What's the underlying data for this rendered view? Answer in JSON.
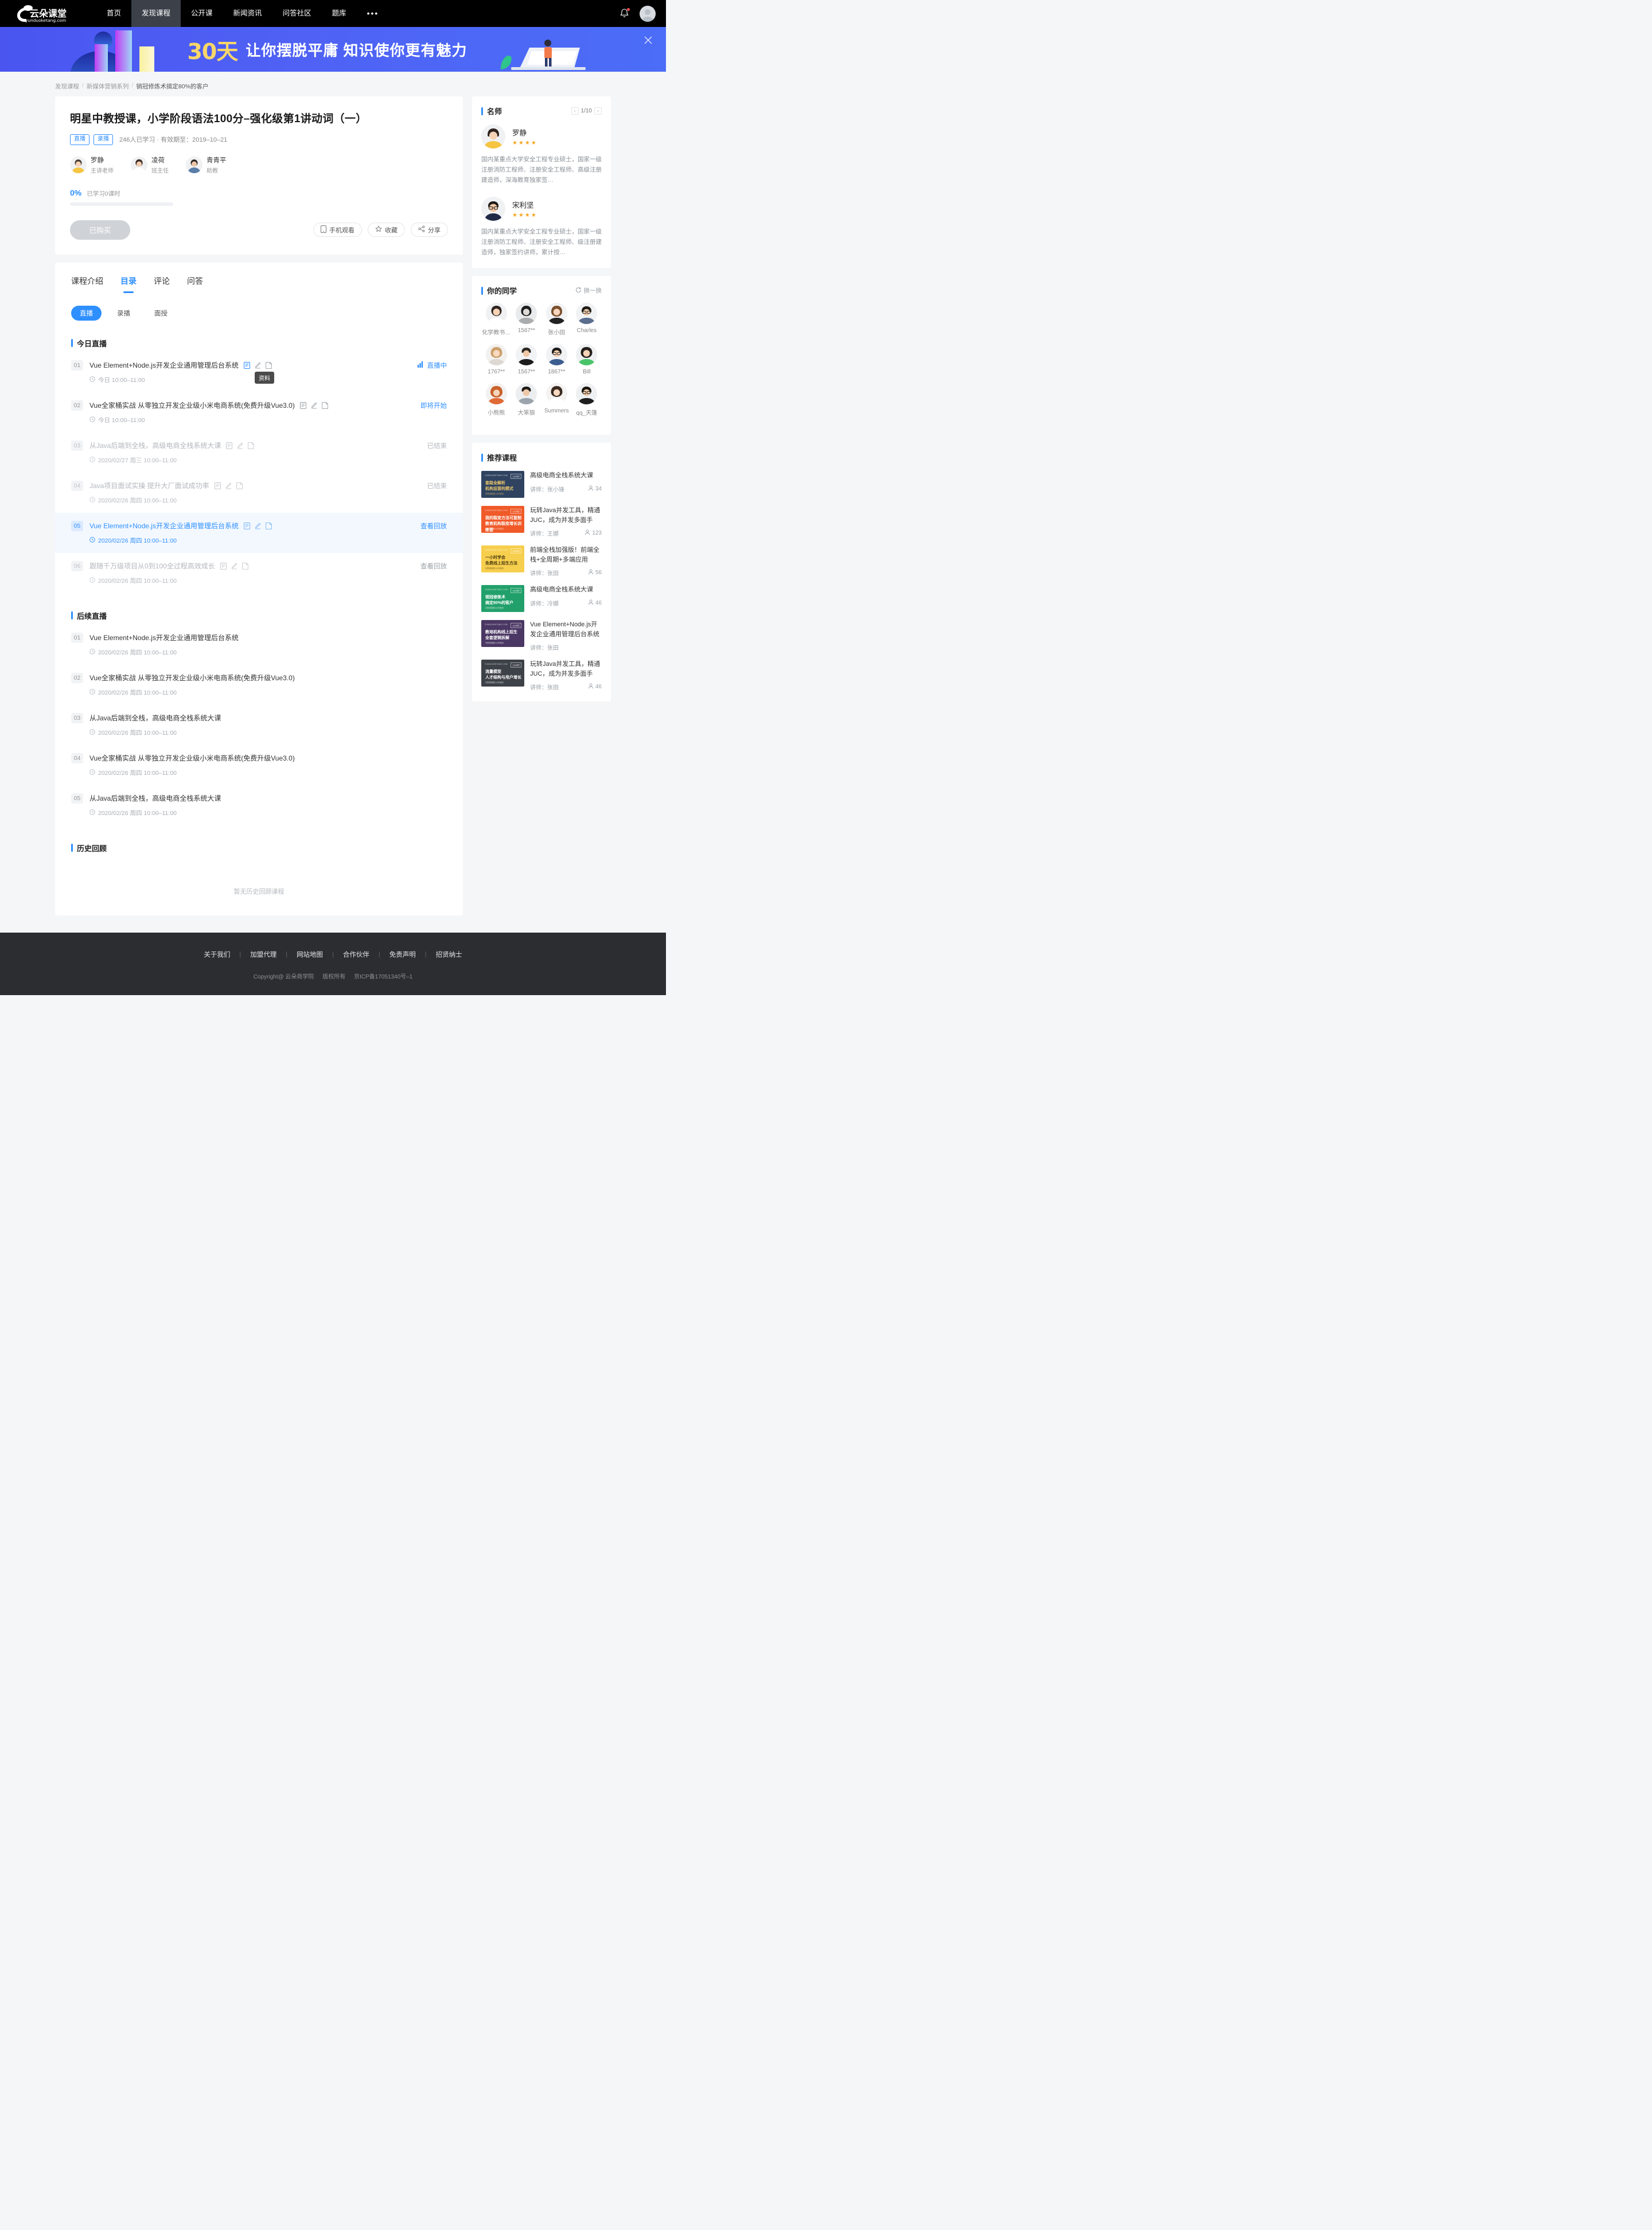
{
  "header": {
    "logo_text": "云朵课堂",
    "logo_sub": "yunduoketang.com",
    "nav": [
      {
        "label": "首页",
        "active": false
      },
      {
        "label": "发现课程",
        "active": true
      },
      {
        "label": "公开课",
        "active": false
      },
      {
        "label": "新闻资讯",
        "active": false
      },
      {
        "label": "问答社区",
        "active": false
      },
      {
        "label": "题库",
        "active": false
      }
    ],
    "more": "•••",
    "bell_icon": "bell-icon",
    "avatar_icon": "user-avatar"
  },
  "banner": {
    "highlight": "30天",
    "text": "让你摆脱平庸  知识使你更有魅力",
    "close_icon": "close-icon"
  },
  "breadcrumb": {
    "items": [
      "发现课程",
      "新媒体营销系列",
      "销冠修炼术搞定80%的客户"
    ],
    "separator": "/"
  },
  "course": {
    "title": "明星中教授课，小学阶段语法100分–强化级第1讲动词（一）",
    "tags": [
      "直播",
      "录播"
    ],
    "meta": "246人已学习 · 有效期至：2019–10–21",
    "teachers": [
      {
        "name": "罗静",
        "role": "主讲老师"
      },
      {
        "name": "凌荷",
        "role": "班主任"
      },
      {
        "name": "青青平",
        "role": "助教"
      }
    ],
    "progress_pct": "0%",
    "progress_label": "已学习0课时",
    "progress_value": 0,
    "buy_button": "已购买",
    "actions": [
      {
        "label": "手机观看",
        "icon": "mobile-icon"
      },
      {
        "label": "收藏",
        "icon": "star-icon"
      },
      {
        "label": "分享",
        "icon": "share-icon"
      }
    ]
  },
  "tabs": [
    {
      "label": "课程介绍",
      "active": false
    },
    {
      "label": "目录",
      "active": true
    },
    {
      "label": "评论",
      "active": false
    },
    {
      "label": "问答",
      "active": false
    }
  ],
  "subtabs": [
    {
      "label": "直播",
      "active": true
    },
    {
      "label": "录播",
      "active": false
    },
    {
      "label": "面授",
      "active": false
    }
  ],
  "tooltip": "资料",
  "sections": {
    "today": {
      "title": "今日直播",
      "lessons": [
        {
          "no": "01",
          "name": "Vue Element+Node.js开发企业通用管理后台系统",
          "time": "今日 10:00–11:00",
          "status": "直播中",
          "status_type": "live",
          "state": "active",
          "icons": [
            "doc-icon",
            "pen-icon",
            "note-icon"
          ]
        },
        {
          "no": "02",
          "name": "Vue全家桶实战 从零独立开发企业级小米电商系统(免费升级Vue3.0)",
          "time": "今日 10:00–11:00",
          "status": "即将开始",
          "status_type": "soon",
          "state": "normal",
          "icons": [
            "doc-icon",
            "pen-icon",
            "note-icon"
          ]
        },
        {
          "no": "03",
          "name": "从Java后端到全栈，高级电商全栈系统大课",
          "time": "2020/02/27 周三 10:00–11:00",
          "status": "已结束",
          "status_type": "ended",
          "state": "past",
          "icons": [
            "doc-icon",
            "pen-icon",
            "note-icon"
          ]
        },
        {
          "no": "04",
          "name": "Java项目面试实操 提升大厂面试成功率",
          "time": "2020/02/26 周四 10:00–11:00",
          "status": "已结束",
          "status_type": "ended",
          "state": "past",
          "icons": [
            "doc-icon",
            "pen-icon",
            "note-icon"
          ]
        },
        {
          "no": "05",
          "name": "Vue Element+Node.js开发企业通用管理后台系统",
          "time": "2020/02/26 周四 10:00–11:00",
          "status": "查看回放",
          "status_type": "replay",
          "state": "highlight",
          "icons": [
            "doc-icon",
            "pen-icon",
            "note-icon"
          ]
        },
        {
          "no": "06",
          "name": "跟随千万级项目从0到100全过程高效成长",
          "time": "2020/02/26 周四 10:00–11:00",
          "status": "查看回放",
          "status_type": "replay-grey",
          "state": "past",
          "icons": [
            "doc-icon",
            "pen-icon",
            "note-icon"
          ]
        }
      ]
    },
    "upcoming": {
      "title": "后续直播",
      "lessons": [
        {
          "no": "01",
          "name": "Vue Element+Node.js开发企业通用管理后台系统",
          "time": "2020/02/26 周四 10:00–11:00"
        },
        {
          "no": "02",
          "name": "Vue全家桶实战 从零独立开发企业级小米电商系统(免费升级Vue3.0)",
          "time": "2020/02/26 周四 10:00–11:00"
        },
        {
          "no": "03",
          "name": "从Java后端到全栈，高级电商全栈系统大课",
          "time": "2020/02/26 周四 10:00–11:00"
        },
        {
          "no": "04",
          "name": "Vue全家桶实战 从零独立开发企业级小米电商系统(免费升级Vue3.0)",
          "time": "2020/02/26 周四 10:00–11:00"
        },
        {
          "no": "05",
          "name": "从Java后端到全栈，高级电商全栈系统大课",
          "time": "2020/02/26 周四 10:00–11:00"
        }
      ]
    },
    "history": {
      "title": "历史回顾",
      "empty": "暂无历史回顾课程"
    }
  },
  "sidebar": {
    "teachers_panel": {
      "title": "名师",
      "page": "1/10",
      "prev_icon": "chevron-left-icon",
      "next_icon": "chevron-right-icon",
      "items": [
        {
          "name": "罗静",
          "stars": "★★★★",
          "desc": "国内某重点大学安全工程专业硕士，国家一级注册消防工程师、注册安全工程师、高级注册建造师，深海教育独家签…"
        },
        {
          "name": "宋利坚",
          "stars": "★★★★",
          "desc": "国内某重点大学安全工程专业硕士，国家一级注册消防工程师、注册安全工程师、级注册建造师，独家签约讲师，累计授…"
        }
      ]
    },
    "classmates_panel": {
      "title": "你的同学",
      "refresh_label": "换一换",
      "refresh_icon": "refresh-icon",
      "items": [
        {
          "name": "化学教书…"
        },
        {
          "name": "1567**"
        },
        {
          "name": "张小田"
        },
        {
          "name": "Charles"
        },
        {
          "name": "1767**"
        },
        {
          "name": "1567**"
        },
        {
          "name": "1867**"
        },
        {
          "name": "Bill"
        },
        {
          "name": "小熊熊"
        },
        {
          "name": "大笨狼"
        },
        {
          "name": "Summers"
        },
        {
          "name": "qq_天篷"
        }
      ]
    },
    "recommend_panel": {
      "title": "推荐课程",
      "teacher_prefix": "讲师：",
      "items": [
        {
          "title": "高级电商全栈系统大课",
          "teacher": "张小锋",
          "count": "34",
          "thumb_color": "#2f4360",
          "thumb_accent": "#f0c96a",
          "thumb_l1": "套路全解析",
          "thumb_l2": "机构运营的模式"
        },
        {
          "title": "玩转Java并发工具，精通JUC，成为并发多面手",
          "teacher": "王娜",
          "count": "123",
          "thumb_color": "#f05a28",
          "thumb_accent": "#ffffff",
          "thumb_l1": "我的裂变方法可复制",
          "thumb_l2": "教育机构裂变增长训练营"
        },
        {
          "title": "前端全栈加强版！前端全栈+全周期+多端应用",
          "teacher": "张田",
          "count": "56",
          "thumb_color": "#f7cf4e",
          "thumb_accent": "#4a3a10",
          "thumb_l1": "一小时学会",
          "thumb_l2": "免费线上招生方法"
        },
        {
          "title": "高级电商全栈系统大课",
          "teacher": "冷娜",
          "count": "46",
          "thumb_color": "#22a06b",
          "thumb_accent": "#ffffff",
          "thumb_l1": "销冠修炼术",
          "thumb_l2": "搞定80%的客户"
        },
        {
          "title": "Vue Element+Node.js开发企业通用管理后台系统",
          "teacher": "张田",
          "count": "",
          "thumb_color": "#4a3763",
          "thumb_accent": "#ffffff",
          "thumb_l1": "教培机构线上招生",
          "thumb_l2": "全套逻辑拆解"
        },
        {
          "title": "玩转Java并发工具，精通JUC，成为并发多面手",
          "teacher": "张田",
          "count": "46",
          "thumb_color": "#3d4148",
          "thumb_accent": "#ffffff",
          "thumb_l1": "流量模型",
          "thumb_l2": "人才结构与用户增长"
        }
      ]
    }
  },
  "footer": {
    "links": [
      "关于我们",
      "加盟代理",
      "网站地图",
      "合作伙伴",
      "免责声明",
      "招贤纳士"
    ],
    "separator": "|",
    "copyright": "Copyright@ 云朵商学院",
    "rights": "版权所有",
    "icp": "京ICP备17051340号–1"
  },
  "colors": {
    "accent": "#2e8fff",
    "banner_bg": "#4a55f0",
    "header_bg": "#000000",
    "footer_bg": "#2b2d31",
    "star": "#f5a623"
  }
}
